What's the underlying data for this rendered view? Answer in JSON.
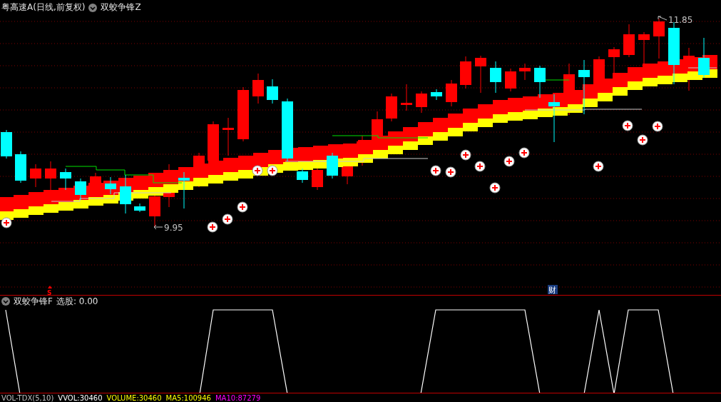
{
  "header": {
    "title": "粤高速A(日线,前复权)",
    "indicator": "双蛟争锋Z"
  },
  "price_chart": {
    "high_label": "11.85",
    "low_label": "9.95",
    "signal_marker": "S",
    "finance_marker": "财"
  },
  "indicator_panel": {
    "name": "双蛟争锋F",
    "readout": "选股: 0.00"
  },
  "volume_bar": {
    "items": [
      {
        "text": "VOL-TDX(5,10)",
        "color": "#c0c0c0"
      },
      {
        "text": "VVOL:30460",
        "color": "#ffffff"
      },
      {
        "text": "VOLUME:30460",
        "color": "#ffff00"
      },
      {
        "text": "MA5:100946",
        "color": "#ffff00"
      },
      {
        "text": "MA10:87279",
        "color": "#ff00ff"
      }
    ]
  }
}
